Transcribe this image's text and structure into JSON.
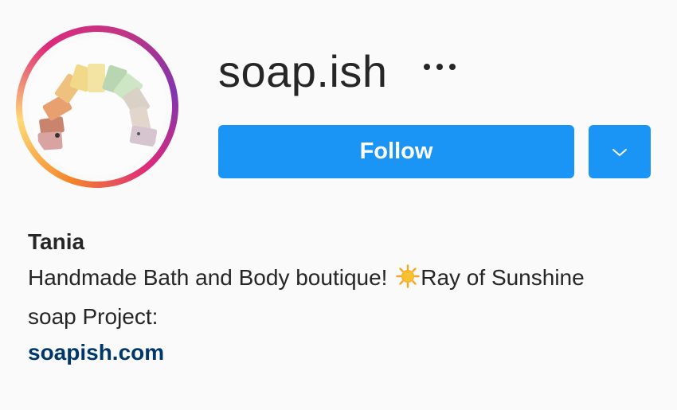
{
  "profile": {
    "username": "soap.ish",
    "display_name": "Tania",
    "bio_before_emoji": "Handmade Bath and Body boutique! ",
    "bio_emoji": "sun-emoji",
    "bio_after_emoji": "Ray of Sunshine soap Project:",
    "website": "soapish.com"
  },
  "actions": {
    "follow_label": "Follow",
    "more_icon": "more-horizontal-icon",
    "dropdown_icon": "chevron-down-icon"
  },
  "colors": {
    "follow_button": "#1a95f6",
    "link": "#00376b",
    "text": "#262626",
    "background": "#fafafa",
    "story_ring": [
      "#f58529",
      "#feda77",
      "#dd2a7b",
      "#8134af"
    ]
  }
}
